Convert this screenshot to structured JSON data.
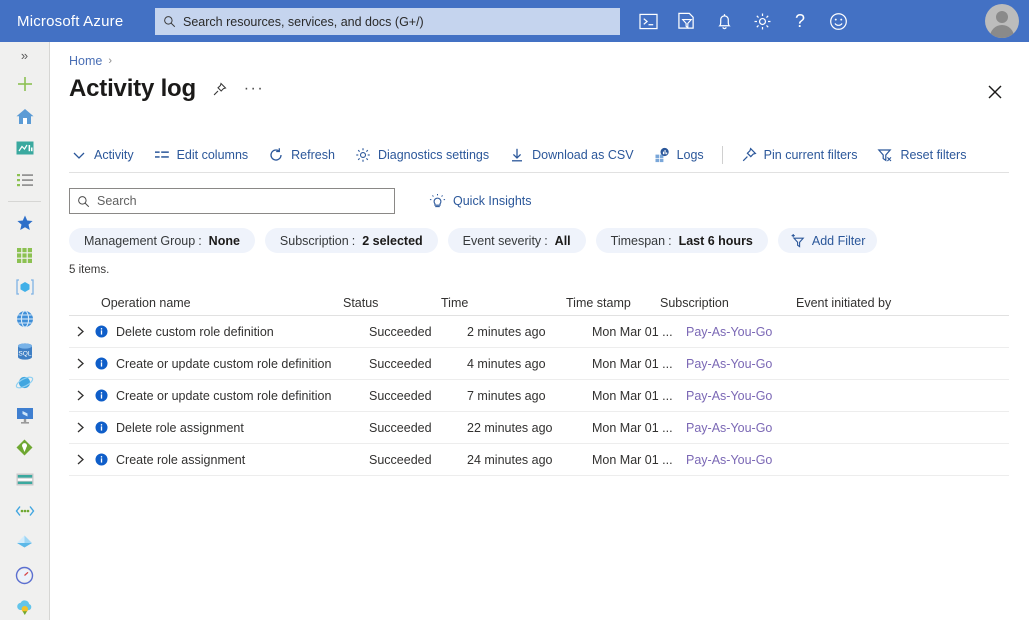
{
  "topbar": {
    "brand": "Microsoft Azure",
    "search_placeholder": "Search resources, services, and docs (G+/)",
    "icons": [
      {
        "name": "cloud-shell-icon",
        "label": "Cloud Shell"
      },
      {
        "name": "directory-filter-icon",
        "label": "Directories + subscriptions"
      },
      {
        "name": "notifications-bell-icon",
        "label": "Notifications"
      },
      {
        "name": "settings-gear-icon",
        "label": "Settings"
      },
      {
        "name": "help-question-icon",
        "label": "Help"
      },
      {
        "name": "feedback-smiley-icon",
        "label": "Feedback"
      }
    ],
    "avatar_label": "Account"
  },
  "rail": {
    "expand_label": "»",
    "items": [
      {
        "name": "rail-create-resource",
        "label": "Create a resource"
      },
      {
        "name": "rail-home",
        "label": "Home"
      },
      {
        "name": "rail-dashboard",
        "label": "Dashboard"
      },
      {
        "name": "rail-all-services",
        "label": "All services"
      },
      {
        "name": "rail-favorites",
        "label": "Favorites"
      },
      {
        "name": "rail-all-resources",
        "label": "All resources"
      },
      {
        "name": "rail-resource-groups",
        "label": "Resource groups"
      },
      {
        "name": "rail-app-services",
        "label": "App Services"
      },
      {
        "name": "rail-sql-databases",
        "label": "SQL databases"
      },
      {
        "name": "rail-azure-cosmos-db",
        "label": "Azure Cosmos DB"
      },
      {
        "name": "rail-virtual-machines",
        "label": "Virtual machines"
      },
      {
        "name": "rail-load-balancers",
        "label": "Load balancers"
      },
      {
        "name": "rail-storage-accounts",
        "label": "Storage accounts"
      },
      {
        "name": "rail-virtual-networks",
        "label": "Virtual networks"
      },
      {
        "name": "rail-azure-active-directory",
        "label": "Azure Active Directory"
      },
      {
        "name": "rail-monitor",
        "label": "Monitor"
      },
      {
        "name": "rail-advisor",
        "label": "Advisor"
      }
    ]
  },
  "page": {
    "breadcrumb_home": "Home",
    "breadcrumb_separator": "›",
    "title": "Activity log",
    "pin_label": "Pin to dashboard",
    "more_label": "···",
    "close_label": "Close"
  },
  "commandbar": {
    "items": [
      {
        "name": "activity-button",
        "label": "Activity",
        "icon": "chevron-down-icon"
      },
      {
        "name": "edit-columns-button",
        "label": "Edit columns",
        "icon": "columns-icon"
      },
      {
        "name": "refresh-button",
        "label": "Refresh",
        "icon": "refresh-icon"
      },
      {
        "name": "diagnostics-settings-button",
        "label": "Diagnostics settings",
        "icon": "gear-icon"
      },
      {
        "name": "download-as-csv-button",
        "label": "Download as CSV",
        "icon": "download-icon"
      },
      {
        "name": "logs-button",
        "label": "Logs",
        "icon": "logs-icon"
      },
      {
        "name": "pin-current-filters-button",
        "label": "Pin current filters",
        "icon": "pin-icon"
      },
      {
        "name": "reset-filters-button",
        "label": "Reset filters",
        "icon": "filter-reset-icon"
      }
    ]
  },
  "search": {
    "placeholder": "Search",
    "value": "",
    "quick_insights_label": "Quick Insights"
  },
  "filters": {
    "pills": [
      {
        "name": "filter-management-group",
        "key": "Management Group",
        "value": "None"
      },
      {
        "name": "filter-subscription",
        "key": "Subscription",
        "value": "2 selected"
      },
      {
        "name": "filter-event-severity",
        "key": "Event severity",
        "value": "All"
      },
      {
        "name": "filter-timespan",
        "key": "Timespan",
        "value": "Last 6 hours"
      }
    ],
    "separator": ":",
    "add_filter_label": "Add Filter"
  },
  "results": {
    "count_text": "5 items.",
    "columns": [
      "Operation name",
      "Status",
      "Time",
      "Time stamp",
      "Subscription",
      "Event initiated by"
    ],
    "rows": [
      {
        "operation": "Delete custom role definition",
        "status": "Succeeded",
        "time": "2 minutes ago",
        "timestamp": "Mon Mar 01 ...",
        "subscription": "Pay-As-You-Go",
        "initiated_by": ""
      },
      {
        "operation": "Create or update custom role definition",
        "status": "Succeeded",
        "time": "4 minutes ago",
        "timestamp": "Mon Mar 01 ...",
        "subscription": "Pay-As-You-Go",
        "initiated_by": ""
      },
      {
        "operation": "Create or update custom role definition",
        "status": "Succeeded",
        "time": "7 minutes ago",
        "timestamp": "Mon Mar 01 ...",
        "subscription": "Pay-As-You-Go",
        "initiated_by": ""
      },
      {
        "operation": "Delete role assignment",
        "status": "Succeeded",
        "time": "22 minutes ago",
        "timestamp": "Mon Mar 01 ...",
        "subscription": "Pay-As-You-Go",
        "initiated_by": ""
      },
      {
        "operation": "Create role assignment",
        "status": "Succeeded",
        "time": "24 minutes ago",
        "timestamp": "Mon Mar 01 ...",
        "subscription": "Pay-As-You-Go",
        "initiated_by": ""
      }
    ],
    "row_expand_label": "›",
    "row_info_label": "Information"
  },
  "colors": {
    "topbar_background": "#4371c4",
    "link_blue": "#2b579a",
    "breadcrumb_blue": "#4a6fb5",
    "pill_background": "#eff3fb",
    "subscription_link": "#7b68b5",
    "info_icon_blue": "#0f6cbd"
  }
}
